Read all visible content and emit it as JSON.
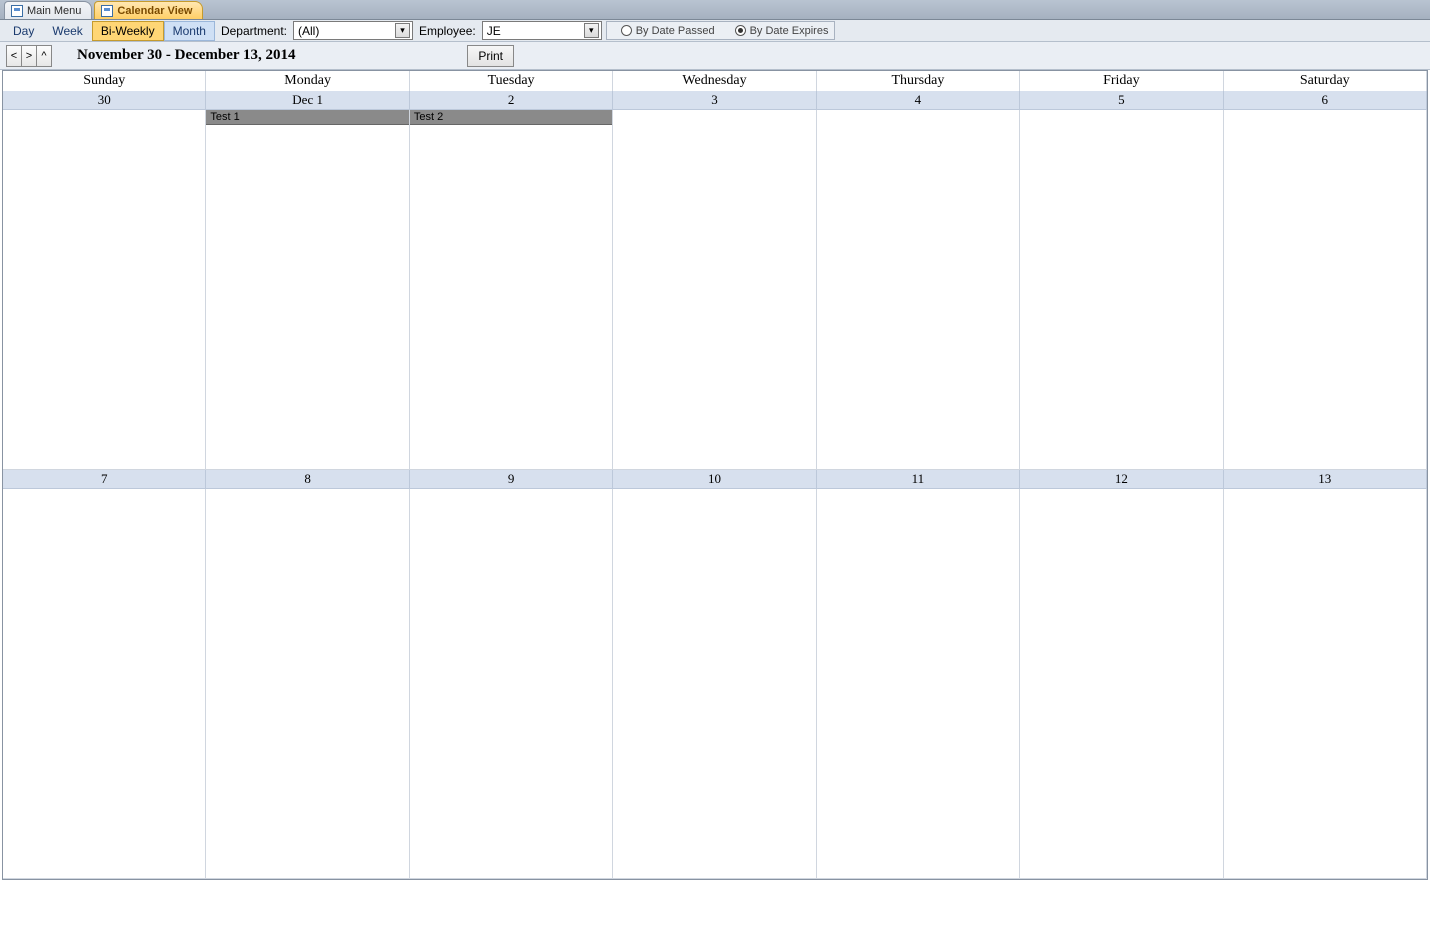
{
  "tabs": {
    "main_menu": "Main Menu",
    "calendar_view": "Calendar View"
  },
  "toolbar": {
    "day": "Day",
    "week": "Week",
    "biweekly": "Bi-Weekly",
    "month": "Month",
    "department_label": "Department:",
    "department_value": "(All)",
    "employee_label": "Employee:",
    "employee_value": "JE",
    "radio_passed": "By Date Passed",
    "radio_expires": "By Date Expires"
  },
  "nav": {
    "prev": "<",
    "next": ">",
    "up": "^",
    "date_range": "November 30 - December 13, 2014",
    "print": "Print"
  },
  "day_headers": [
    "Sunday",
    "Monday",
    "Tuesday",
    "Wednesday",
    "Thursday",
    "Friday",
    "Saturday"
  ],
  "week1_dates": [
    "30",
    "Dec 1",
    "2",
    "3",
    "4",
    "5",
    "6"
  ],
  "week2_dates": [
    "7",
    "8",
    "9",
    "10",
    "11",
    "12",
    "13"
  ],
  "events": {
    "w1d1": "Test 1",
    "w1d2": "Test 2"
  }
}
